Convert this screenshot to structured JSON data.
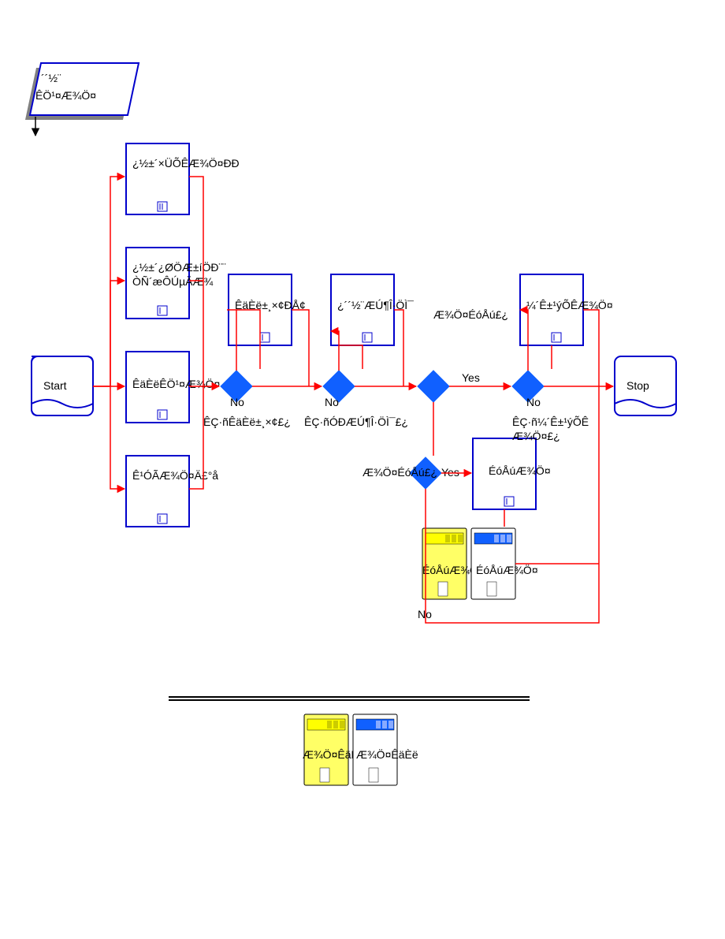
{
  "title_card": {
    "line1": "´´½¨",
    "line2": "ÊÖ¹¤Æ¾Ö¤"
  },
  "start_label": "Start",
  "stop_label": "Stop",
  "processes": {
    "p1": "¿½±´×ÜÕÊÆ¾Ö¤ÐÐ",
    "p2a": "¿½±´¿ØÖÆ±íÖÐ¨¨",
    "p2b": "ÒÑ´æÔÚµÄÆ¾",
    "p3": "ÊäÈëÊÖ¹¤Æ¾Ö¤",
    "p4": "Ê¹ÓÃÆ¾Ö¤Ä£°å",
    "p5": "ÊäÈë±¸×¢ÐÅ¢",
    "p6": "¿´´½¨ÆÚ¶Î·ÖÌ¯",
    "p7": "Æ¾Ö¤ÉóÅú£¿",
    "p8": "¼´Ê±¹ýÕÊÆ¾Ö¤",
    "p9": "ÉóÅúÆ¾Ö¤",
    "p10": "ÉóÅúÆ¾Ö¤",
    "p11": "ÉóÅúÆ¾Ö¤"
  },
  "decisions": {
    "d1_q": "ÊÇ·ñÊäÈë±¸×¢£¿",
    "d2_q": "ÊÇ·ñÓÐÆÚ¶Î·ÖÌ¯£¿",
    "d3_q_a": "ÊÇ·ñ¼´Ê±¹ýÕÊ",
    "d3_q_b": "Æ¾Ö¤£¿",
    "d4_q": "Æ¾Ö¤ÉóÅú£¿"
  },
  "branch_labels": {
    "yes": "Yes",
    "no": "No"
  },
  "legend": {
    "left": "Æ¾Ö¤ÊäÈë",
    "right": "Æ¾Ö¤ÊäÈë"
  }
}
